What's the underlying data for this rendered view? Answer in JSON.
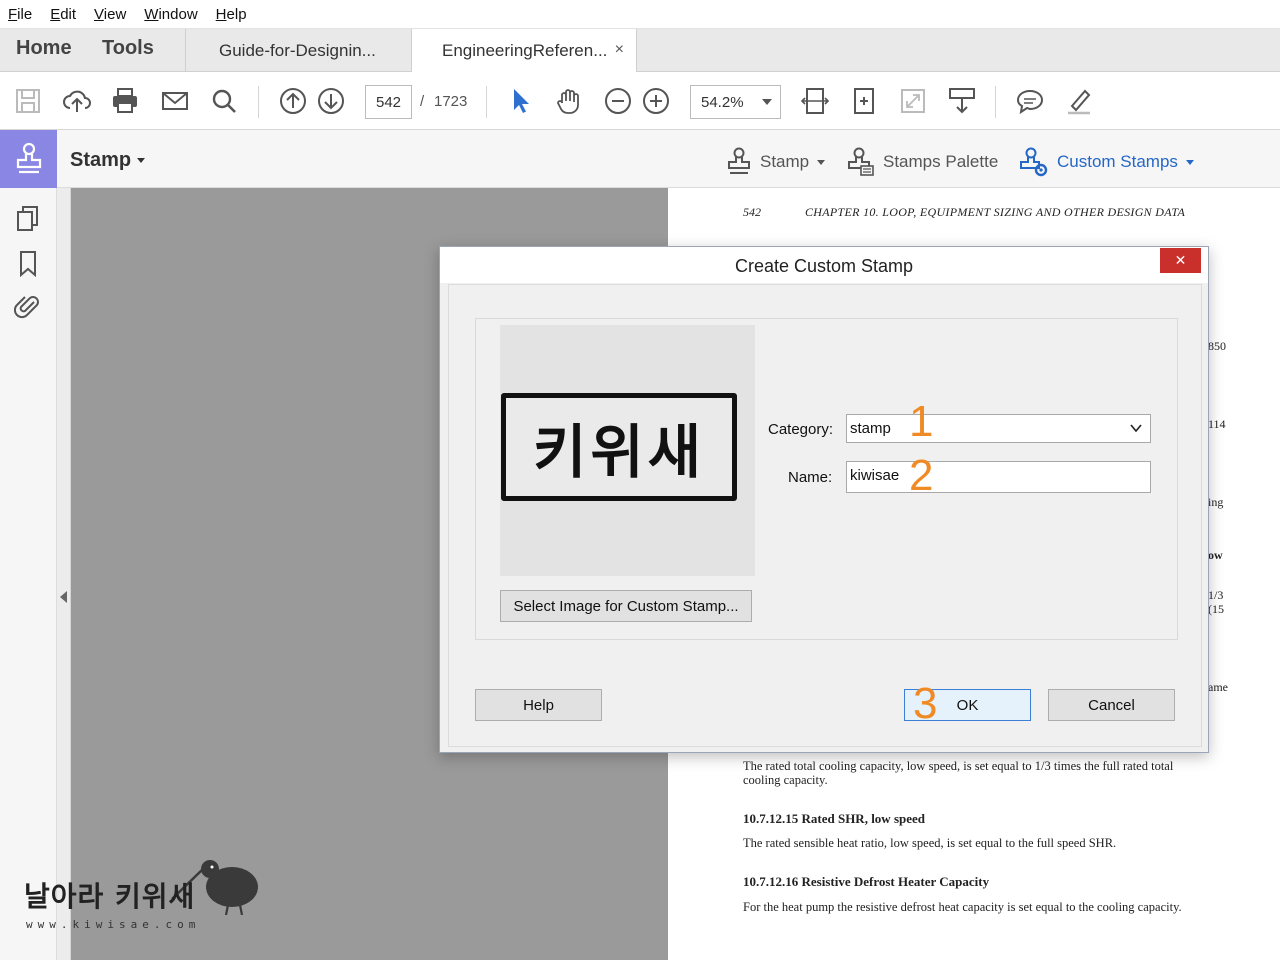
{
  "menu": {
    "items": [
      "File",
      "Edit",
      "View",
      "Window",
      "Help"
    ]
  },
  "tabs": {
    "home": "Home",
    "tools": "Tools",
    "docs": [
      {
        "label": "Guide-for-Designin..."
      },
      {
        "label": "EngineeringReferen...",
        "active": true
      }
    ],
    "close_glyph": "×"
  },
  "toolbar": {
    "page_current": "542",
    "page_separator": "/",
    "page_total": "1723",
    "zoom": "54.2%"
  },
  "stamp_toolbar": {
    "title": "Stamp",
    "stamp_menu": "Stamp",
    "stamps_palette": "Stamps Palette",
    "custom_stamps": "Custom Stamps",
    "accent": "#8a86e4",
    "link_color": "#2467c6"
  },
  "document": {
    "page_number": "542",
    "running_head": "CHAPTER 10.  LOOP, EQUIPMENT SIZING AND OTHER DESIGN DATA",
    "fragments": [
      "850",
      "114",
      "ing",
      "ow",
      "1/3",
      "(15",
      "ame"
    ],
    "paragraph_1_line_1": "The rated total cooling capacity, low speed, is set equal to 1/3 times the full rated total",
    "paragraph_1_line_2": "cooling capacity.",
    "section_1": "10.7.12.15   Rated SHR, low speed",
    "paragraph_2": "The rated sensible heat ratio, low speed, is set equal to the full speed SHR.",
    "section_2": "10.7.12.16   Resistive Defrost Heater Capacity",
    "paragraph_3": "For the heat pump the resistive defrost heat capacity is set equal to the cooling capacity."
  },
  "dialog": {
    "title": "Create Custom Stamp",
    "close_glyph": "✕",
    "stamp_image_text": "키위새",
    "select_image_button": "Select Image for Custom Stamp...",
    "category_label": "Category:",
    "category_value": "stamp",
    "name_label": "Name:",
    "name_value": "kiwisae",
    "help_button": "Help",
    "ok_button": "OK",
    "cancel_button": "Cancel",
    "callouts": [
      "1",
      "2",
      "3"
    ],
    "callout_color": "#f08a24",
    "close_color": "#c9302c"
  },
  "watermark": {
    "text": "날아라 키위새",
    "url": "www.kiwisae.com"
  }
}
